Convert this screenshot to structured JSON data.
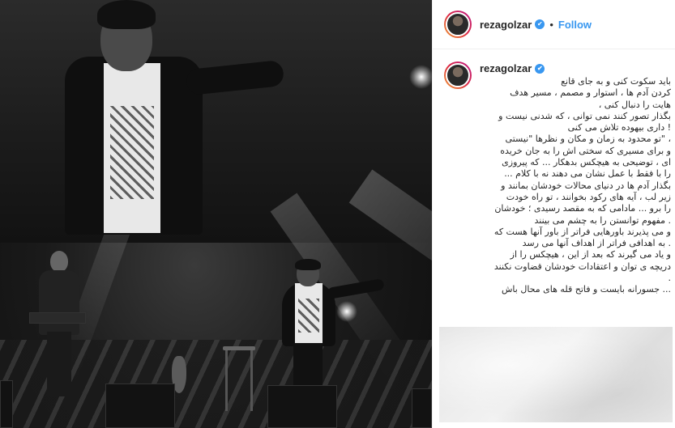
{
  "post": {
    "username": "rezagolzar",
    "follow_label": "Follow",
    "separator": "•",
    "verified_glyph": "✔",
    "caption_lines": [
      "باید سکوت کنی و به جای قانع",
      "کردن آدم ها ، استوار و مصمم ، مسیر هدف",
      "هایت را دنبال کنی ،",
      "بگذار تصور کنند نمی توانی ، که شدنی نیست و",
      "! داری بیهوده تلاش می کنی",
      "، \"تو محدود به زمان و مکان و نظرها \"نیستی",
      "و برای مسیری که سختی اش را به جان خریده",
      "ای ، توضیحی به هیچکس بدهکار ... که پیروزی",
      "را با فقط با عمل نشان می دهند نه با کلام ...",
      "بگذار آدم ها در دنیای محالات خودشان بمانند و",
      "زیر لب ، آیه های رکود بخوانند ، تو راه خودت",
      "را برو ... مادامی که به مقصد رسیدی ؛ خودشان",
      ". مفهوم توانستن را به چشم می بینند",
      "و می پذیرند باورهایی فراتر از باور آنها هست که",
      ". به اهدافی فراتر از اهداف آنها می رسد",
      "و یاد می گیرند که بعد از این ، هیچکس را از",
      "دریچه ی توان و اعتقادات خودشان قضاوت نکنند",
      ".",
      "... جسورانه بایست و فاتح قله های محال باش"
    ]
  },
  "colors": {
    "accent_blue": "#3897f0",
    "text": "#262626",
    "border": "#efefef"
  },
  "icons": {
    "verified": "verified-badge-icon"
  }
}
